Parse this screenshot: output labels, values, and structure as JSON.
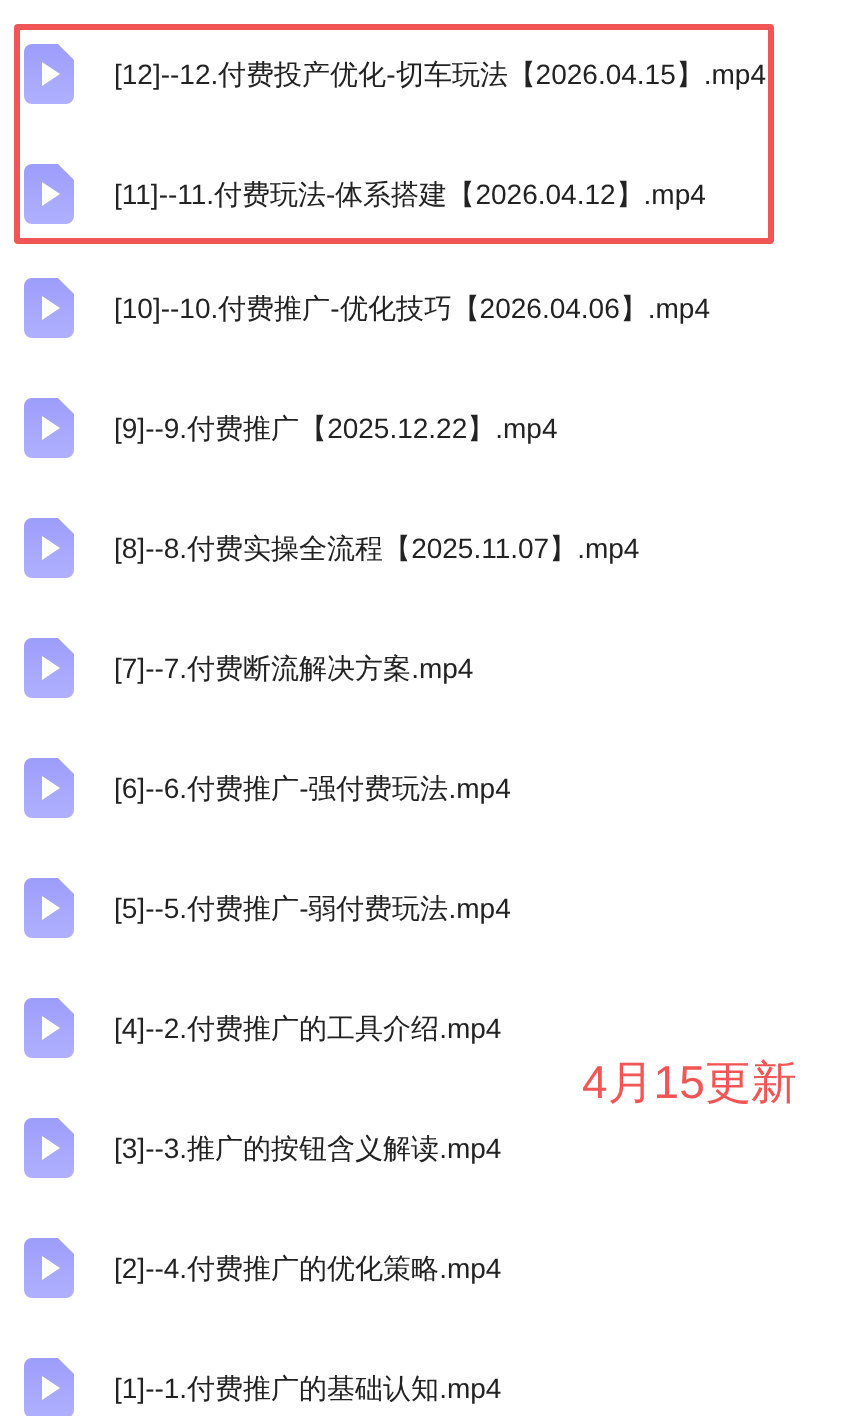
{
  "files": [
    {
      "name": "[12]--12.付费投产优化-切车玩法【2026.04.15】.mp4",
      "highlighted": true
    },
    {
      "name": "[11]--11.付费玩法-体系搭建【2026.04.12】.mp4",
      "highlighted": true
    },
    {
      "name": "[10]--10.付费推广-优化技巧【2026.04.06】.mp4",
      "highlighted": false
    },
    {
      "name": "[9]--9.付费推广【2025.12.22】.mp4",
      "highlighted": false
    },
    {
      "name": "[8]--8.付费实操全流程【2025.11.07】.mp4",
      "highlighted": false
    },
    {
      "name": "[7]--7.付费断流解决方案.mp4",
      "highlighted": false
    },
    {
      "name": "[6]--6.付费推广-强付费玩法.mp4",
      "highlighted": false
    },
    {
      "name": "[5]--5.付费推广-弱付费玩法.mp4",
      "highlighted": false
    },
    {
      "name": "[4]--2.付费推广的工具介绍.mp4",
      "highlighted": false
    },
    {
      "name": "[3]--3.推广的按钮含义解读.mp4",
      "highlighted": false
    },
    {
      "name": "[2]--4.付费推广的优化策略.mp4",
      "highlighted": false
    },
    {
      "name": "[1]--1.付费推广的基础认知.mp4",
      "highlighted": false
    }
  ],
  "annotation": "4月15更新"
}
